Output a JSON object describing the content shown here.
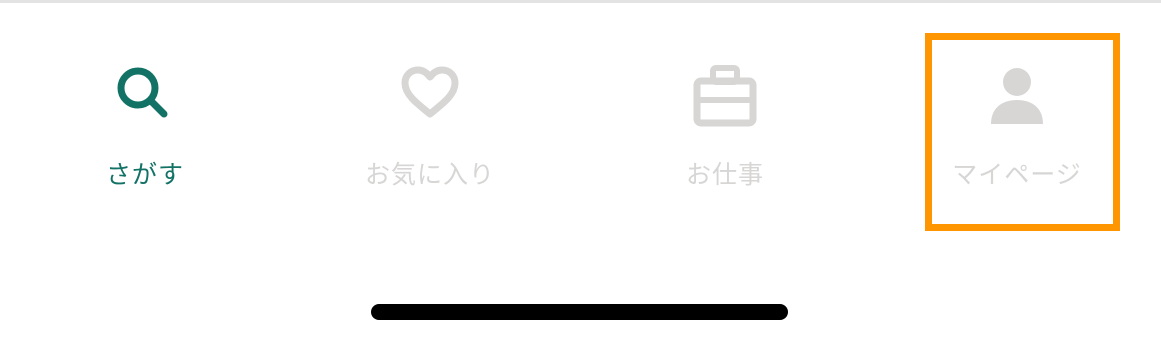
{
  "colors": {
    "active": "#137266",
    "inactive": "#d7d6d5",
    "highlight": "#ff9500",
    "home_indicator": "#000000"
  },
  "tabs": [
    {
      "id": "search",
      "label": "さがす",
      "icon": "search-icon",
      "active": true
    },
    {
      "id": "favorites",
      "label": "お気に入り",
      "icon": "heart-icon",
      "active": false
    },
    {
      "id": "work",
      "label": "お仕事",
      "icon": "briefcase-icon",
      "active": false
    },
    {
      "id": "mypage",
      "label": "マイページ",
      "icon": "person-icon",
      "active": false,
      "highlighted": true
    }
  ]
}
